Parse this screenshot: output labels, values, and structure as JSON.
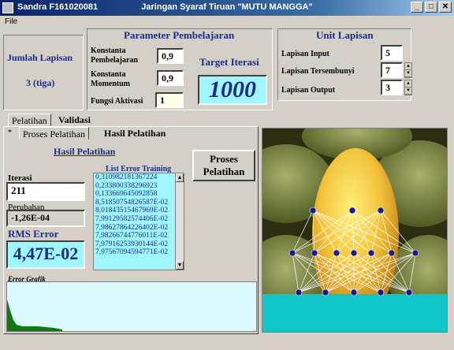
{
  "window": {
    "user": "Sandra F161020081",
    "title": "Jaringan Syaraf Tiruan \"MUTU MANGGA\"",
    "buttons": [
      "_",
      "7",
      "X"
    ]
  },
  "menu": {
    "file": "File"
  },
  "left_box": {
    "label": "Jumlah Lapisan",
    "value": "3 (tiga)"
  },
  "params": {
    "title": "Parameter Pembelajaran",
    "konstanta_pembelajaran_label": "Konstanta Pembelajaran",
    "konstanta_pembelajaran_value": "0,9",
    "konstanta_momentum_label": "Konstanta Momentum",
    "konstanta_momentum_value": "0,9",
    "fungsi_aktivasi_label": "Fungsi Aktivasi",
    "fungsi_aktivasi_value": "1",
    "target_label": "Target Iterasi",
    "target_value": "1000"
  },
  "unit": {
    "title": "Unit Lapisan",
    "input_label": "Lapisan Input",
    "input_value": "5",
    "hidden_label": "Lapisan Tersembunyi",
    "hidden_value": "7",
    "output_label": "Lapisan Output",
    "output_value": "3"
  },
  "tabs": {
    "main": [
      "Pelatihan",
      "Validasi"
    ],
    "sub_marker": "*",
    "sub": [
      "Proses Pelatihan",
      "Hasil Pelatihan"
    ]
  },
  "results": {
    "title": "Hasil Pelatihan",
    "iterasi_label": "Iterasi",
    "iterasi_value": "211",
    "perubahan_label": "Perubahan",
    "perubahan_value": "-1,26E-04",
    "rms_label": "RMS Error",
    "rms_value": "4,47E-02",
    "list_title": "List Error Training",
    "list_items": [
      "0,310982181367224",
      "0,233800338296923",
      "0,133669645092858",
      "8,51850754826587E-02",
      "8,01843515467969E-02",
      "7,99129582574406E-02",
      "7,98627864226402E-02",
      "7,98266744776011E-02",
      "7,97916253930144E-02",
      "7,97567094594771E-02"
    ],
    "proses_button": "Proses Pelatihan",
    "grafik_label": "Error Grafik"
  },
  "colors": {
    "title_navy": "#1c2c86",
    "list_cyan": "#9ff6ff",
    "node_color": "#1a1a8a"
  }
}
